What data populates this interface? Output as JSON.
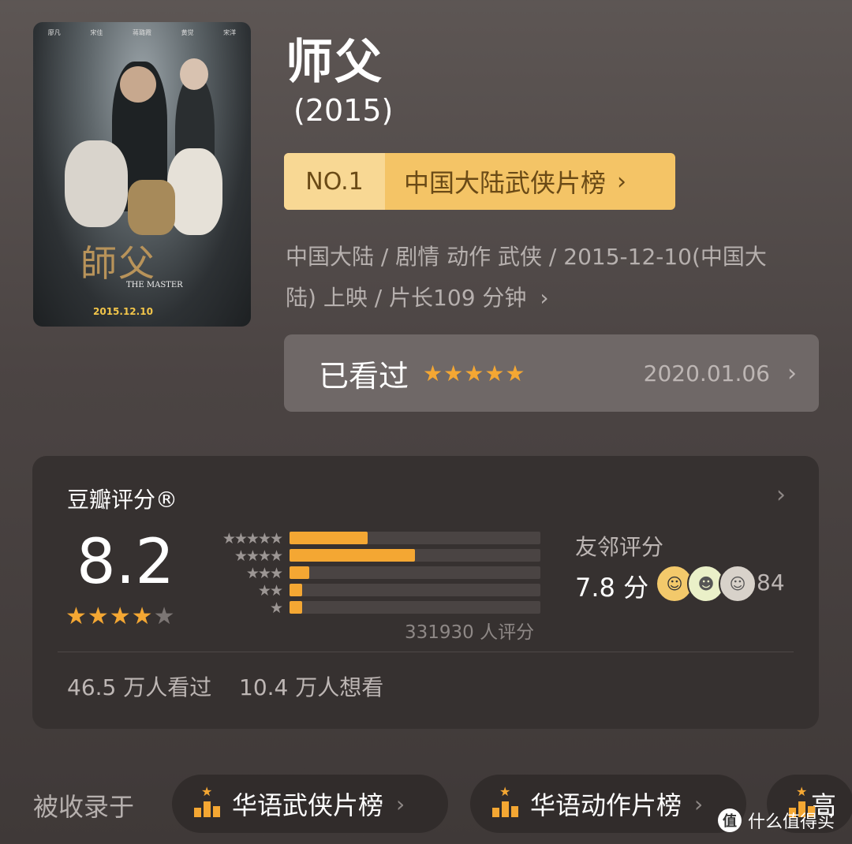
{
  "movie": {
    "title": "师父",
    "year": "(2015)",
    "poster": {
      "cast": [
        "廖凡",
        "宋佳",
        "蒋璐霞",
        "黄觉",
        "宋洋"
      ],
      "title_text": "師父",
      "subtitle": "THE MASTER",
      "release_text": "2015.12.10"
    },
    "rank": {
      "no": "NO.1",
      "list": "中国大陆武侠片榜"
    },
    "meta_line1": "中国大陆 / 剧情 动作 武侠 / 2015-12-10(中国大",
    "meta_line2": "陆) 上映 / 片长109 分钟",
    "watched": {
      "label": "已看过",
      "stars": "★★★★★",
      "date": "2020.01.06"
    }
  },
  "rating": {
    "title": "豆瓣评分®",
    "score": "8.2",
    "stars_on": "★★★★",
    "stars_off": "★",
    "star_rows": [
      "★★★★★",
      "★★★★",
      "★★★",
      "★★",
      "★"
    ],
    "distribution": [
      0.31,
      0.5,
      0.08,
      0.05,
      0.05
    ],
    "count": "331930 人评分",
    "friend_label": "友邻评分",
    "friend_score": "7.8 分",
    "friend_count": "84",
    "seen": "46.5 万人看过",
    "want": "10.4 万人想看"
  },
  "included": {
    "label": "被收录于",
    "chips": [
      "华语武侠片榜",
      "华语动作片榜",
      "高"
    ]
  },
  "watermark": {
    "logo": "值",
    "text": "什么值得买"
  },
  "colors": {
    "accent": "#f4a733",
    "badge": "#f4c466",
    "card": "#363130"
  }
}
